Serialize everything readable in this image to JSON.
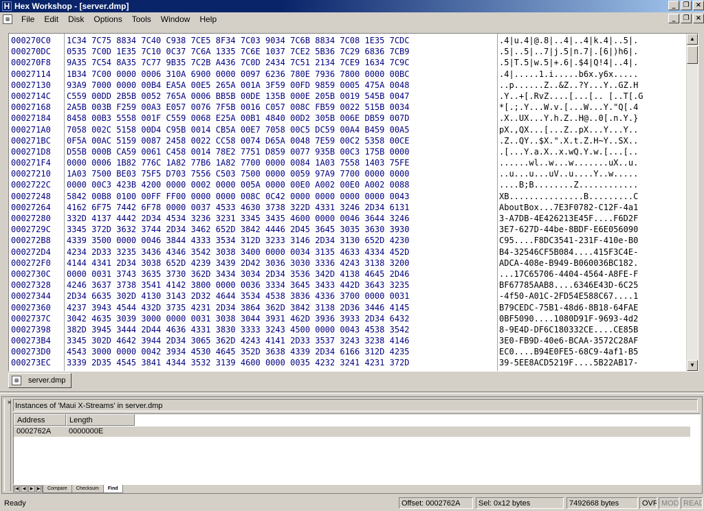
{
  "window": {
    "title": "Hex Workshop - [server.dmp]",
    "app_icon_label": "H"
  },
  "menu": [
    "File",
    "Edit",
    "Disk",
    "Options",
    "Tools",
    "Window",
    "Help"
  ],
  "hex": {
    "rows": [
      {
        "addr": "000270C0",
        "hex": "1C34 7C75 8834 7C40 C938 7CE5 8F34 7C03 9034 7C6B 8834 7C08 1E35 7CDC",
        "ascii": ".4|u.4|@.8|..4|..4|k.4|..5|."
      },
      {
        "addr": "000270DC",
        "hex": "0535 7C0D 1E35 7C10 0C37 7C6A 1335 7C6E 1037 7CE2 5B36 7C29 6836 7CB9",
        "ascii": ".5|..5|..7|j.5|n.7|.[6|)h6|."
      },
      {
        "addr": "000270F8",
        "hex": "9A35 7C54 8A35 7C77 9B35 7C2B A436 7C0D 2434 7C51 2134 7CE9 1634 7C9C",
        "ascii": ".5|T.5|w.5|+.6|.$4|Q!4|..4|."
      },
      {
        "addr": "00027114",
        "hex": "1B34 7C00 0000 0006 310A 6900 0000 0097 6236 780E 7936 7800 0000 00BC",
        "ascii": ".4|.....1.i.....b6x.y6x....."
      },
      {
        "addr": "00027130",
        "hex": "93A9 7000 0000 00B4 EA5A 00E5 265A 001A 3F59 00FD 9859 0005 475A 0048",
        "ascii": "..p......Z..&Z..?Y...Y..GZ.H"
      },
      {
        "addr": "0002714C",
        "hex": "C559 00DD 2B5B 0052 765A 0006 BB5B 00DE 135B 000E 205B 0019 545B 0047",
        "ascii": ".Y..+[.RvZ....[...[.. [..T[.G"
      },
      {
        "addr": "00027168",
        "hex": "2A5B 003B F259 00A3 E057 0076 7F5B 0016 C057 008C FB59 0022 515B 0034",
        "ascii": "*[.;.Y...W.v.[...W...Y.\"Q[.4"
      },
      {
        "addr": "00027184",
        "hex": "8458 00B3 5558 001F C559 0068 E25A 00B1 4840 00D2 305B 006E DB59 007D",
        "ascii": ".X..UX...Y.h.Z..H@..0[.n.Y.}"
      },
      {
        "addr": "000271A0",
        "hex": "7058 002C 5158 00D4 C95B 0014 CB5A 00E7 7058 00C5 DC59 00A4 B459 00A5",
        "ascii": "pX.,QX...[...Z..pX...Y...Y.."
      },
      {
        "addr": "000271BC",
        "hex": "0F5A 00AC 5159 0087 2458 0022 CC58 0074 D65A 0048 7E59 00C2 5358 00CE",
        "ascii": ".Z..QY..$X.\".X.t.Z.H~Y..SX.."
      },
      {
        "addr": "000271D8",
        "hex": "D55B 000B CA59 0061 C458 0014 78E2 7751 D859 0077 935B 00C3 175B 0000",
        "ascii": ".[...Y.a.X..x.wQ.Y.w.[...[.."
      },
      {
        "addr": "000271F4",
        "hex": "0000 0006 1B82 776C 1A82 77B6 1A82 7700 0000 0084 1A03 7558 1403 75FE",
        "ascii": "......wl..w...w.......uX..u."
      },
      {
        "addr": "00027210",
        "hex": "1A03 7500 BE03 75F5 D703 7556 C503 7500 0000 0059 97A9 7700 0000 0000",
        "ascii": "..u...u...uV..u....Y..w....."
      },
      {
        "addr": "0002722C",
        "hex": "0000 00C3 423B 4200 0000 0002 0000 005A 0000 00E0 A002 00E0 A002 0088",
        "ascii": "....B;B........Z............"
      },
      {
        "addr": "00027248",
        "hex": "5842 00B8 0100 00FF FF00 0000 0000 008C 0C42 0000 0000 0000 0000 0043",
        "ascii": "XB...............B.........C"
      },
      {
        "addr": "00027264",
        "hex": "4162 6F75 7442 6F78 0000 0037 4533 4630 3738 322D 4331 3246 2D34 6131",
        "ascii": "AboutBox...7E3F0782-C12F-4a1"
      },
      {
        "addr": "00027280",
        "hex": "332D 4137 4442 2D34 4534 3236 3231 3345 3435 4600 0000 0046 3644 3246",
        "ascii": "3-A7DB-4E426213E45F....F6D2F"
      },
      {
        "addr": "0002729C",
        "hex": "3345 372D 3632 3744 2D34 3462 652D 3842 4446 2D45 3645 3035 3630 3930",
        "ascii": "3E7-627D-44be-8BDF-E6E056090"
      },
      {
        "addr": "000272B8",
        "hex": "4339 3500 0000 0046 3844 4333 3534 312D 3233 3146 2D34 3130 652D 4230",
        "ascii": "C95....F8DC3541-231F-410e-B0"
      },
      {
        "addr": "000272D4",
        "hex": "4234 2D33 3235 3436 4346 3542 3038 3400 0000 0034 3135 4633 4334 452D",
        "ascii": "B4-32546CF5B084....415F3C4E-"
      },
      {
        "addr": "000272F0",
        "hex": "4144 4341 2D34 3038 652D 4239 3439 2D42 3036 3030 3336 4243 3138 3200",
        "ascii": "ADCA-408e-B949-B060036BC182."
      },
      {
        "addr": "0002730C",
        "hex": "0000 0031 3743 3635 3730 362D 3434 3034 2D34 3536 342D 4138 4645 2D46",
        "ascii": "...17C65706-4404-4564-A8FE-F"
      },
      {
        "addr": "00027328",
        "hex": "4246 3637 3738 3541 4142 3800 0000 0036 3334 3645 3433 442D 3643 3235",
        "ascii": "BF67785AAB8....6346E43D-6C25"
      },
      {
        "addr": "00027344",
        "hex": "2D34 6635 302D 4130 3143 2D32 4644 3534 4538 3836 4336 3700 0000 0031",
        "ascii": "-4f50-A01C-2FD54E588C67....1"
      },
      {
        "addr": "00027360",
        "hex": "4237 3943 4544 432D 3735 4231 2D34 3864 362D 3842 3138 2D36 3446 4145",
        "ascii": "B79CEDC-75B1-48d6-8B18-64FAE"
      },
      {
        "addr": "0002737C",
        "hex": "3042 4635 3039 3000 0000 0031 3038 3044 3931 462D 3936 3933 2D34 6432",
        "ascii": "0BF5090....1080D91F-9693-4d2"
      },
      {
        "addr": "00027398",
        "hex": "382D 3945 3444 2D44 4636 4331 3830 3333 3243 4500 0000 0043 4538 3542",
        "ascii": "8-9E4D-DF6C180332CE....CE85B"
      },
      {
        "addr": "000273B4",
        "hex": "3345 302D 4642 3944 2D34 3065 362D 4243 4141 2D33 3537 3243 3238 4146",
        "ascii": "3E0-FB9D-40e6-BCAA-3572C28AF"
      },
      {
        "addr": "000273D0",
        "hex": "4543 3000 0000 0042 3934 4530 4645 352D 3638 4339 2D34 6166 312D 4235",
        "ascii": "EC0....B94E0FE5-68C9-4af1-B5"
      },
      {
        "addr": "000273EC",
        "hex": "3339 2D35 4545 3841 4344 3532 3139 4600 0000 0035 4232 3241 4231 372D",
        "ascii": "39-5EE8ACD5219F....5B22AB17-"
      }
    ]
  },
  "doc_tab": {
    "label": "server.dmp"
  },
  "results_panel": {
    "title": "Instances of 'Maui X-Streams' in server.dmp",
    "columns": [
      "Address",
      "Length"
    ],
    "rows": [
      {
        "address": "0002762A",
        "length": "0000000E"
      }
    ],
    "tabs": [
      "Compare",
      "Checksum",
      "Find"
    ],
    "active_tab": "Find"
  },
  "status": {
    "ready": "Ready",
    "offset": "Offset: 0002762A",
    "selection": "Sel: 0x12 bytes",
    "size": "7492668 bytes",
    "ovr": "OVR",
    "mod": "MOD",
    "read": "READ"
  }
}
